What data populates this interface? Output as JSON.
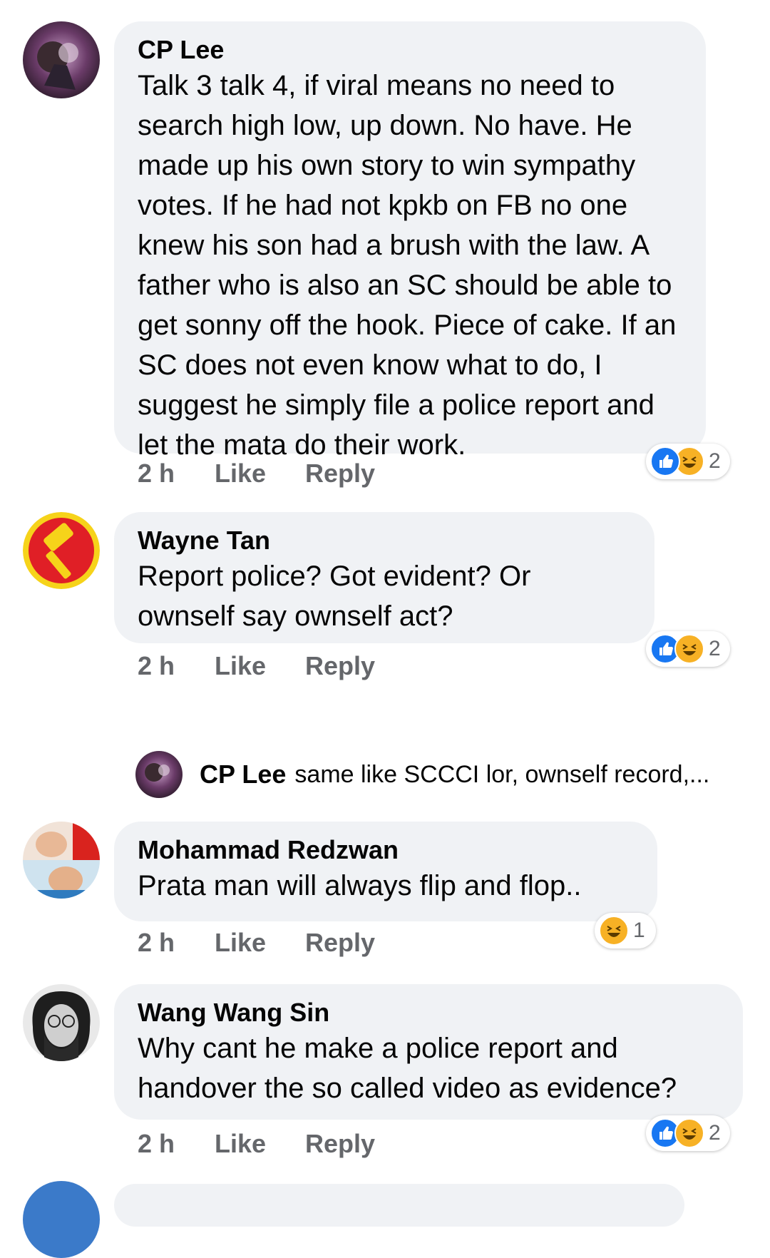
{
  "comments": [
    {
      "author": "CP Lee",
      "text": "Talk 3 talk 4, if viral means no need to search high low, up down. No have. He made up his own story to win sympathy votes. If he had not kpkb on FB no one knew his son had a brush with the law. A father who is also an SC should be able to get sonny off the hook. Piece of cake. If an SC does not even know what to do, I suggest he simply file a police report and let the mata do their work.",
      "time": "2 h",
      "like": "Like",
      "reply": "Reply",
      "reaction_count": "2",
      "reactions": [
        "like-icon",
        "haha-icon"
      ]
    },
    {
      "author": "Wayne Tan",
      "text": "Report police? Got evident? Or ownself say ownself act?",
      "time": "2 h",
      "like": "Like",
      "reply": "Reply",
      "reaction_count": "2",
      "reactions": [
        "like-icon",
        "haha-icon"
      ]
    },
    {
      "author": "Mohammad Redzwan",
      "text": "Prata man will always flip and flop..",
      "time": "2 h",
      "like": "Like",
      "reply": "Reply",
      "reaction_count": "1",
      "reactions": [
        "haha-icon"
      ]
    },
    {
      "author": "Wang Wang Sin",
      "text": "Why cant he make a police report and handover the so called video as evidence?",
      "time": "2 h",
      "like": "Like",
      "reply": "Reply",
      "reaction_count": "2",
      "reactions": [
        "like-icon",
        "haha-icon"
      ]
    }
  ],
  "reply_preview": {
    "author": "CP Lee",
    "text": "same like SCCCI lor, ownself record,..."
  },
  "colors": {
    "bubble": "#f0f2f5",
    "meta_text": "#65676b",
    "like_blue": "#1877f2",
    "haha_yellow": "#f7b125"
  }
}
